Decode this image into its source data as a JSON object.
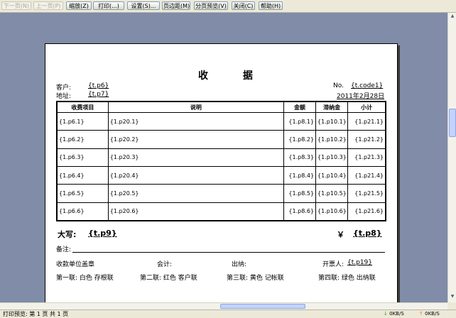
{
  "toolbar": {
    "next_page": "下一页(N)",
    "prev_page": "上一页(P)",
    "zoom": "缩放(Z)",
    "print": "打印(...)",
    "settings": "设置(S)...",
    "margins": "页边距(M)",
    "page_preview": "分页预览(V)",
    "close": "关闭(C)",
    "help": "帮助(H)"
  },
  "receipt": {
    "title": "收 据",
    "customer_label": "客户:",
    "customer_value": "{t.p6}",
    "address_label": "地址:",
    "address_value": "{t.p7}",
    "no_label": "No.",
    "no_value": "{t.code1}",
    "date": "2011年2月28日",
    "columns": [
      "收费项目",
      "说明",
      "金额",
      "滞纳金",
      "小计"
    ],
    "rows": [
      [
        "{1.p6.1}",
        "{1.p20.1}",
        "{1.p8.1}",
        "{1.p10.1}",
        "{1.p21.1}"
      ],
      [
        "{1.p6.2}",
        "{1.p20.2}",
        "{1.p8.2}",
        "{1.p10.2}",
        "{1.p21.2}"
      ],
      [
        "{1.p6.3}",
        "{1.p20.3}",
        "{1.p8.3}",
        "{1.p10.3}",
        "{1.p21.3}"
      ],
      [
        "{1.p6.4}",
        "{1.p20.4}",
        "{1.p8.4}",
        "{1.p10.4}",
        "{1.p21.4}"
      ],
      [
        "{1.p6.5}",
        "{1.p20.5}",
        "{1.p8.5}",
        "{1.p10.5}",
        "{1.p21.5}"
      ],
      [
        "{1.p6.6}",
        "{1.p20.6}",
        "{1.p8.6}",
        "{1.p10.6}",
        "{1.p21.6}"
      ]
    ],
    "daxie_label": "大写:",
    "daxie_value": "{t.p9}",
    "yen_symbol": "￥",
    "yen_value": "{t.p8}",
    "remark_label": "备注:",
    "seal_label": "收款单位盖章",
    "accountant_label": "会计:",
    "cashier_label": "出纳:",
    "issuer_label": "开票人:",
    "issuer_value": "{t.p19}",
    "copy1": "第一联: 白色 存根联",
    "copy2": "第二联: 红色 客户联",
    "copy3": "第三联: 黄色 记帐联",
    "copy4": "第四联: 绿色 出纳联"
  },
  "status": {
    "text": "打印预览: 第 1 页  共 1 页",
    "down_rate": "0KB/S",
    "up_rate": "0KB/S"
  }
}
